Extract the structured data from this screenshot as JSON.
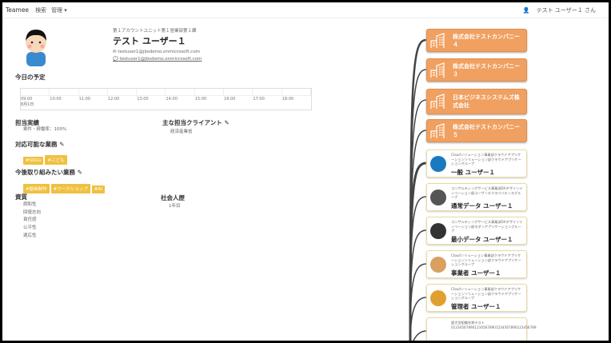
{
  "nav": {
    "brand": "Teamee",
    "search": "検索",
    "manage": "管理 ▾",
    "user": "テスト ユーザー１ さん"
  },
  "profile": {
    "department": "第１アカウントユニット第１営業部第１課",
    "name": "テスト ユーザー１",
    "email": "testuser1@jbsdemo.onmicrosoft.com",
    "chat": "testuser1@jbsdemo.onmicrosoft.com"
  },
  "schedule": {
    "title": "今日の予定",
    "times": [
      "09:00",
      "10:00",
      "11:00",
      "12:00",
      "13:00",
      "14:00",
      "15:00",
      "16:00",
      "17:00",
      "18:00"
    ],
    "date": "8月1日"
  },
  "performance": {
    "title": "担当実績",
    "value": "案件・稼働率：100%"
  },
  "clients": {
    "title": "主な担当クライアント",
    "value": "経済産業省"
  },
  "skills": {
    "title": "対応可能な業務",
    "tags": [
      "#SDGs",
      "#こども"
    ]
  },
  "wishes": {
    "title": "今後取り組みたい業務",
    "tags": [
      "#動画制作",
      "#ワークショップ",
      "#AI"
    ]
  },
  "traits": {
    "title": "資質",
    "items": [
      "調和性",
      "回復志向",
      "責任感",
      "公平性",
      "適応性"
    ]
  },
  "career": {
    "title": "社会人歴",
    "value": "1年目"
  },
  "orgs": [
    "株式会社テストカンパニー４",
    "株式会社テストカンパニー３",
    "日本ビジネスシステムズ株式会社",
    "株式会社テストカンパニー５"
  ],
  "users": [
    {
      "desc": "Cloudソリューション事業部クラウドアプリケーションソリューション部クラウドアプリケーショングループ",
      "name": "一般 ユーザー１",
      "color": "#1a7ac0"
    },
    {
      "desc": "コンサルティングサービス事業部DXデザインイノベーション部ユーザーエクスペリエンスグループ",
      "name": "通常データ ユーザー１",
      "color": "#555"
    },
    {
      "desc": "コンサルティングサービス事業部DXデザインイノベーション部モダンアプリケーショングループ",
      "name": "最小データ ユーザー１",
      "color": "#333"
    },
    {
      "desc": "Cloudソリューション事業部クラウドアプリケーションソリューション部クラウドアプリケーショングループ",
      "name": "事業者 ユーザー１",
      "color": "#d9a060"
    },
    {
      "desc": "Cloudソリューション事業部クラウドアプリケーションソリューション部クラウドアプリケーショングループ",
      "name": "管理者 ユーザー１",
      "color": "#e0a030"
    },
    {
      "desc": "超大型組織名称テスト0123456789012345678901234567890123456789",
      "name": "",
      "color": "#fff"
    }
  ]
}
